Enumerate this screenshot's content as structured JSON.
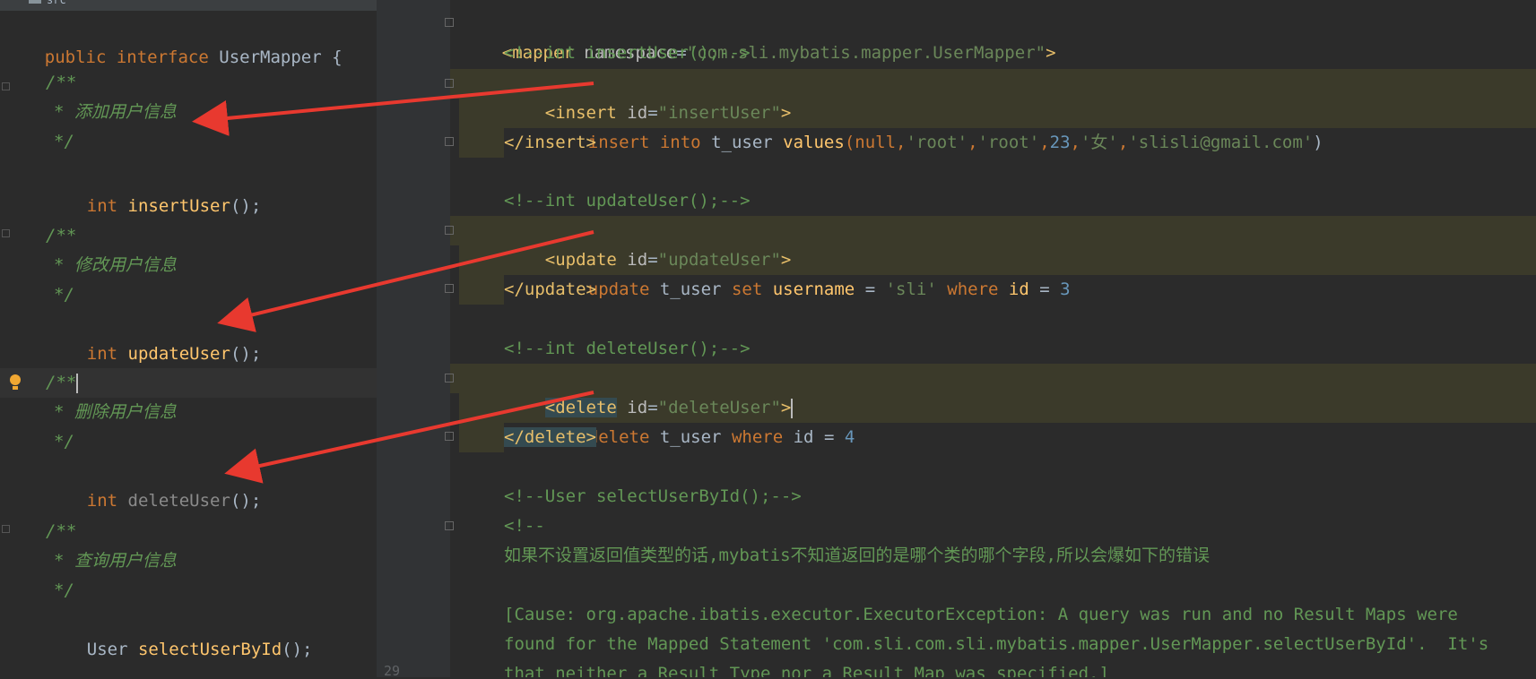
{
  "sidebar": {
    "folder_label": "src"
  },
  "gutter": {
    "line_number": "29"
  },
  "java": {
    "decl": {
      "kw1": "public",
      "kw2": "interface",
      "name": "UserMapper",
      "brace": "{"
    },
    "doc_open": "/**",
    "doc_close": "*/",
    "methods": [
      {
        "comment": "* 添加用户信息",
        "type": "int",
        "name": "insertUser",
        "suffix": "();"
      },
      {
        "comment": "* 修改用户信息",
        "type": "int",
        "name": "updateUser",
        "suffix": "();"
      },
      {
        "comment": "* 删除用户信息",
        "type": "int",
        "name": "deleteUser",
        "suffix": "();"
      },
      {
        "comment": "* 查询用户信息",
        "type": "User",
        "name": "selectUserById",
        "suffix": "();"
      }
    ]
  },
  "xml": {
    "mapper_open": "<mapper",
    "namespace_attr": "namespace",
    "namespace_val": "\"com.sli.mybatis.mapper.UserMapper\"",
    "gt": ">",
    "eq": "=",
    "comment_insert": "<!--int insertUser();-->",
    "insert_open": "<insert",
    "insert_id": "\"insertUser\"",
    "insert_sql": {
      "kw1": "insert",
      "kw2": "into",
      "table": "t_user",
      "kw3": "values",
      "p1": "(null,",
      "s1": "'root'",
      "c1": ",",
      "s2": "'root'",
      "c2": ",",
      "n1": "23",
      "c3": ",",
      "s3": "'女'",
      "c4": ",",
      "s4": "'slisli@gmail.com'",
      "p2": ")"
    },
    "insert_close": "</insert>",
    "comment_update": "<!--int updateUser();-->",
    "update_open": "<update",
    "update_id": "\"updateUser\"",
    "update_sql": {
      "kw1": "update",
      "table": "t_user",
      "kw2": "set",
      "col": "username",
      "eq": "=",
      "val": "'sli'",
      "kw3": "where",
      "col2": "id",
      "eq2": "=",
      "num": "3"
    },
    "update_close": "</update>",
    "comment_delete": "<!--int deleteUser();-->",
    "delete_open": "<delete",
    "delete_id": "\"deleteUser\"",
    "delete_sql": {
      "kw1": "delete",
      "table": "t_user",
      "kw2": "where",
      "col": "id",
      "eq": "=",
      "num": "4"
    },
    "delete_close": "</delete>",
    "comment_select": "<!--User selectUserById();-->",
    "comment_block_open": "<!--",
    "note_line": "如果不设置返回值类型的话,mybatis不知道返回的是哪个类的哪个字段,所以会爆如下的错误",
    "error_lines": [
      "[Cause: org.apache.ibatis.executor.ExecutorException: A query was run and no Result Maps were",
      "found for the Mapped Statement 'com.sli.com.sli.mybatis.mapper.UserMapper.selectUserById'.  It's",
      "that neither a Result Type nor a Result Map was specified.]"
    ]
  },
  "colors": {
    "background": "#2b2b2b",
    "keyword": "#cc7832",
    "method": "#ffc66d",
    "comment": "#629755",
    "string": "#6a8759",
    "number": "#6897bb",
    "tag": "#e8bf6a",
    "arrow": "#e8392f"
  }
}
